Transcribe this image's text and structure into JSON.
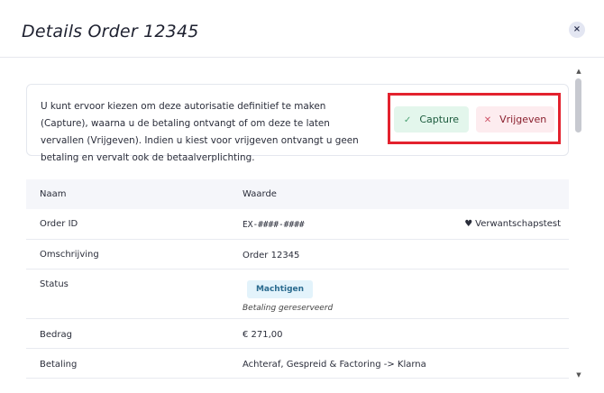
{
  "modal": {
    "title": "Details Order 12345",
    "close_icon": "×"
  },
  "info": {
    "text": "U kunt ervoor kiezen om deze autorisatie definitief te maken (Capture), waarna u de betaling ontvangt of om deze te laten vervallen (Vrijgeven). Indien u kiest voor vrijgeven ontvangt u geen betaling en vervalt ook de betaalverplichting."
  },
  "actions": {
    "capture": {
      "icon": "check-icon",
      "glyph": "✓",
      "label": "Capture",
      "color": "#e3f6ec"
    },
    "release": {
      "icon": "x-icon",
      "glyph": "✕",
      "label": "Vrijgeven",
      "color": "#fdecef"
    },
    "highlight_color": "#e3222e"
  },
  "table": {
    "headers": {
      "name": "Naam",
      "value": "Waarde"
    },
    "rows": {
      "order_id": {
        "label": "Order ID",
        "value": "EX-####-####",
        "tag_icon": "shield-icon",
        "tag_glyph": "♥",
        "tag": "Verwantschapstest"
      },
      "description": {
        "label": "Omschrijving",
        "value": "Order 12345"
      },
      "status": {
        "label": "Status",
        "badge": "Machtigen",
        "note": "Betaling gereserveerd"
      },
      "amount": {
        "label": "Bedrag",
        "value": "€ 271,00"
      },
      "payment": {
        "label": "Betaling",
        "value": "Achteraf, Gespreid & Factoring -> Klarna"
      }
    }
  },
  "scrollbar": {
    "up": "▲",
    "down": "▼"
  }
}
